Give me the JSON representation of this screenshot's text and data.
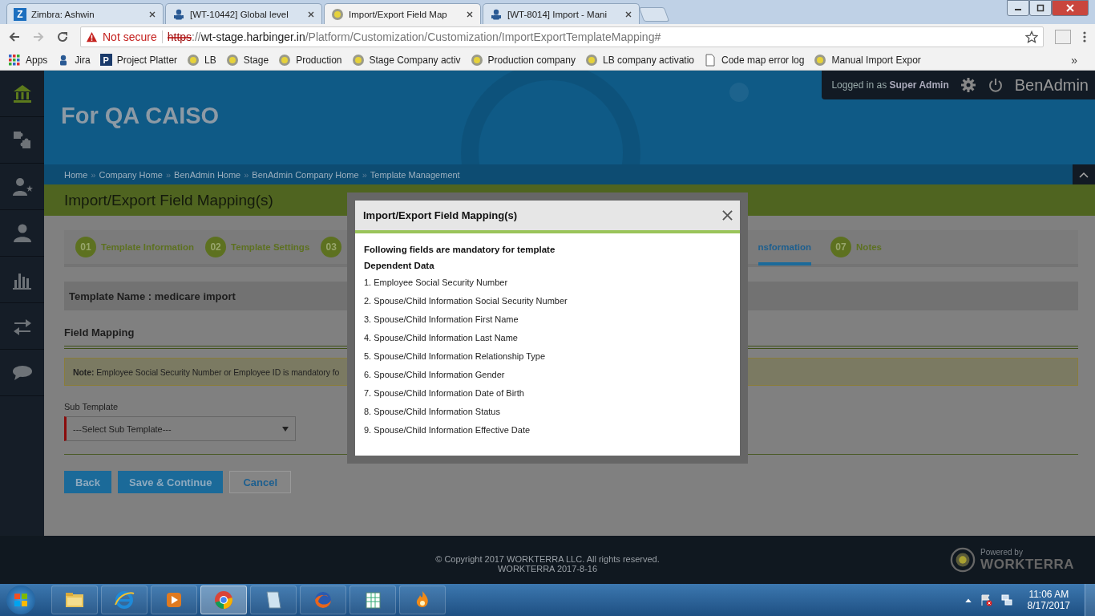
{
  "browser": {
    "tabs": [
      {
        "title": "Zimbra: Ashwin",
        "kind": "letter",
        "icon_text": "Z",
        "selected": false
      },
      {
        "title": "[WT-10442] Global level",
        "kind": "jira",
        "selected": false
      },
      {
        "title": "Import/Export Field Map",
        "kind": "circle",
        "selected": true
      },
      {
        "title": "[WT-8014] Import - Mani",
        "kind": "jira",
        "selected": false
      }
    ],
    "address": {
      "security": "Not secure",
      "scheme": "https",
      "separator": "://",
      "host": "wt-stage.harbinger.in",
      "path": "/Platform/Customization/Customization/ImportExportTemplateMapping#"
    },
    "bookmarks": [
      {
        "label": "Apps",
        "kind": "apps"
      },
      {
        "label": "Jira",
        "kind": "jira"
      },
      {
        "label": "Project Platter",
        "kind": "letter",
        "icon_text": "P"
      },
      {
        "label": "LB",
        "kind": "circle"
      },
      {
        "label": "Stage",
        "kind": "circle"
      },
      {
        "label": "Production",
        "kind": "circle"
      },
      {
        "label": "Stage Company activ",
        "kind": "circle"
      },
      {
        "label": "Production company",
        "kind": "circle"
      },
      {
        "label": "LB company activatio",
        "kind": "circle"
      },
      {
        "label": "Code map error log",
        "kind": "page"
      },
      {
        "label": "Manual Import Expor",
        "kind": "circle"
      }
    ],
    "more_bookmarks": "»"
  },
  "sidebar": {
    "items": [
      {
        "kind": "home",
        "selected": true
      },
      {
        "kind": "puzzle",
        "selected": false
      },
      {
        "kind": "user-star",
        "selected": false
      },
      {
        "kind": "user",
        "selected": false
      },
      {
        "kind": "chart",
        "selected": false
      },
      {
        "kind": "arrows",
        "selected": false
      },
      {
        "kind": "chat",
        "selected": false
      }
    ]
  },
  "header": {
    "company": "For QA CAISO",
    "user": "Logged in as **Super Admin**",
    "product": "BenAdmin"
  },
  "breadcrumb": [
    {
      "label": "Home",
      "separator": "»"
    },
    {
      "label": "Company Home",
      "separator": "»"
    },
    {
      "label": "BenAdmin Home",
      "separator": "»"
    },
    {
      "label": "BenAdmin Company Home",
      "separator": "»"
    },
    {
      "label": "Template Management"
    }
  ],
  "page_title": "Import/Export Field Mapping(s)",
  "steps_left": [
    {
      "number": "01",
      "label": "Template Information",
      "selected": false
    },
    {
      "number": "02",
      "label": "Template Settings",
      "selected": false
    },
    {
      "number": "03",
      "selected": false
    }
  ],
  "steps_right": [
    {
      "label": "nsformation",
      "selected": true
    },
    {
      "number": "07",
      "label": "Notes",
      "selected": false
    }
  ],
  "template_name": "Template Name : medicare import",
  "section_title": "Field Mapping",
  "note": "**Note:** Employee Social Security Number or Employee ID is mandatory fo",
  "sub_template": {
    "label": "Sub Template",
    "placeholder": "---Select Sub Template---",
    "required": true
  },
  "buttons": [
    {
      "label": "Back",
      "kind": "primary"
    },
    {
      "label": "Save & Continue",
      "kind": "primary"
    },
    {
      "label": "Cancel",
      "kind": "secondary"
    }
  ],
  "modal": {
    "title": "Import/Export Field Mapping(s)",
    "heading": "Following fields are mandatory for template",
    "subheading": "Dependent Data",
    "items": [
      "1. Employee Social Security Number",
      "2. Spouse/Child Information Social Security Number",
      "3. Spouse/Child Information First Name",
      "4. Spouse/Child Information Last Name",
      "5. Spouse/Child Information Relationship Type",
      "6. Spouse/Child Information Gender",
      "7. Spouse/Child Information Date of Birth",
      "8. Spouse/Child Information Status",
      "9. Spouse/Child Information Effective Date"
    ]
  },
  "footer": {
    "copyright": "© Copyright 2017 WORKTERRA LLC. All rights reserved.",
    "version": "WORKTERRA 2017-8-16",
    "powered_by": "Powered by",
    "brand": "WORKTERRA"
  },
  "taskbar": {
    "apps": [
      {
        "kind": "folder",
        "selected": false
      },
      {
        "kind": "ie",
        "selected": false
      },
      {
        "kind": "media",
        "selected": false
      },
      {
        "kind": "chrome",
        "selected": true
      },
      {
        "kind": "notepad",
        "selected": false
      },
      {
        "kind": "firefox",
        "selected": false
      },
      {
        "kind": "sheet",
        "selected": false
      },
      {
        "kind": "flame",
        "selected": false
      }
    ],
    "time": "11:06 AM",
    "date": "8/17/2017"
  }
}
